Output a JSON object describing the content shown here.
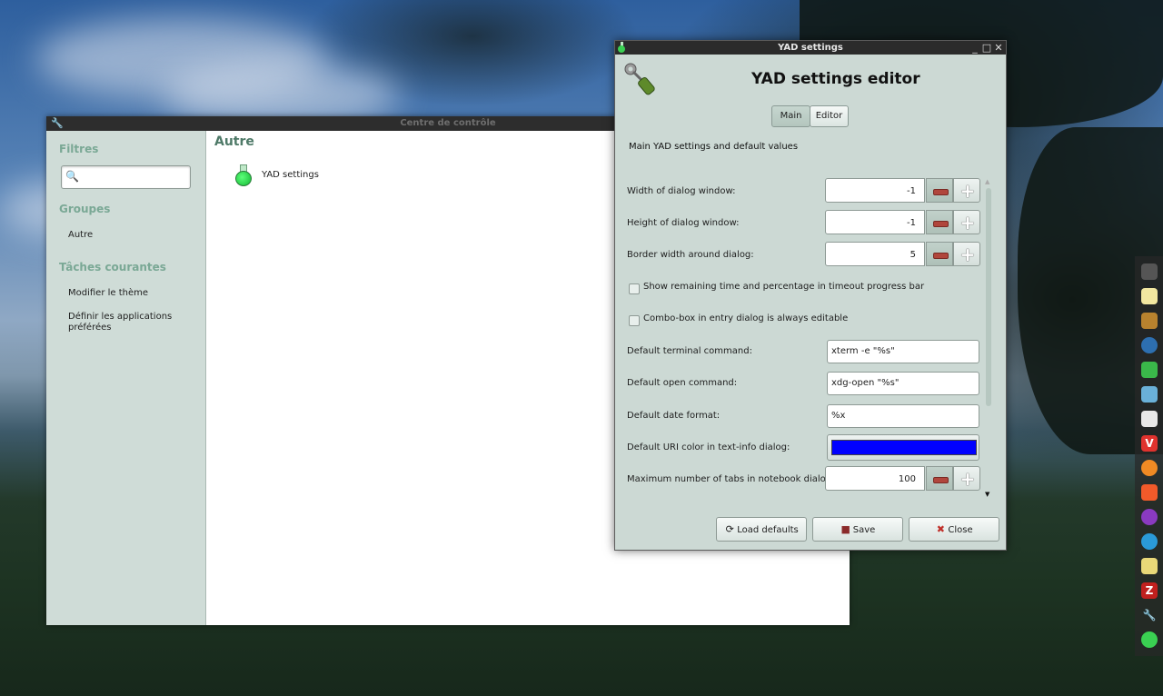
{
  "control_center": {
    "title": "Centre de contrôle",
    "sidebar": {
      "filters_heading": "Filtres",
      "search_placeholder": "",
      "groups_heading": "Groupes",
      "groups": [
        "Autre"
      ],
      "tasks_heading": "Tâches courantes",
      "tasks": [
        "Modifier le thème",
        "Définir les applications préférées"
      ]
    },
    "main": {
      "section_title": "Autre",
      "launchers": [
        {
          "label": "YAD settings",
          "icon": "flask-icon"
        }
      ]
    }
  },
  "yad_dialog": {
    "title": "YAD settings",
    "header_title": "YAD settings editor",
    "header_icon": "settings-editor-icon",
    "tabs": [
      {
        "label": "Main",
        "active": true
      },
      {
        "label": "Editor",
        "active": false
      }
    ],
    "description": "Main YAD settings and default values",
    "fields": {
      "width": {
        "label": "Width of dialog window:",
        "value": "-1"
      },
      "height": {
        "label": "Height of dialog window:",
        "value": "-1"
      },
      "border": {
        "label": "Border width around dialog:",
        "value": "5"
      },
      "show_remaining": {
        "label": "Show remaining time and percentage in timeout progress bar",
        "checked": false
      },
      "combo_editable": {
        "label": "Combo-box in entry dialog is always editable",
        "checked": false
      },
      "terminal": {
        "label": "Default terminal command:",
        "value": "xterm -e \"%s\""
      },
      "open": {
        "label": "Default open command:",
        "value": "xdg-open \"%s\""
      },
      "date_format": {
        "label": "Default date format:",
        "value": "%x"
      },
      "uri_color": {
        "label": "Default URI color in text-info dialog:",
        "value": "#0000ff"
      },
      "max_tabs": {
        "label": "Maximum number of tabs in notebook dialog:",
        "value": "100"
      }
    },
    "buttons": {
      "load_defaults": "Load defaults",
      "save": "Save",
      "close": "Close"
    }
  },
  "dock": {
    "icons": [
      "terminal-icon",
      "text-editor-icon",
      "archive-icon",
      "network-icon",
      "yad-icon",
      "screen-icon",
      "mail-icon",
      "vivaldi-icon",
      "firefox-icon",
      "brave-icon",
      "firefox-dev-icon",
      "telegram-icon",
      "flask-icon",
      "filezilla-icon",
      "wrench-icon",
      "flask-icon"
    ]
  },
  "colors": {
    "sidebar_bg": "#cfdcd7",
    "heading_green": "#7aa895",
    "dialog_bg": "#ccd9d4",
    "uri_color": "#0000ff"
  }
}
